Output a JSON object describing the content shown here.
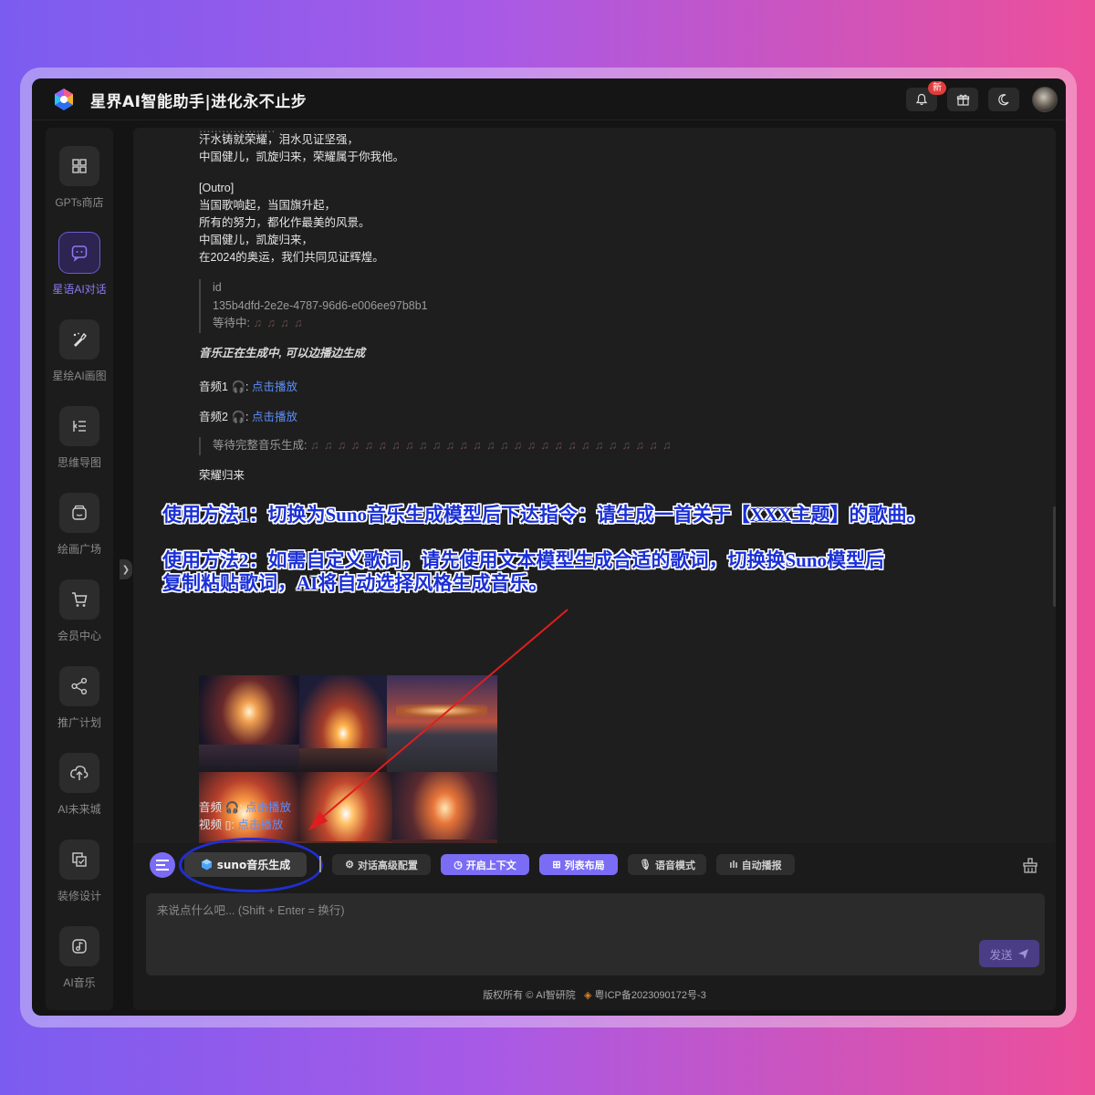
{
  "app": {
    "title": "星界AI智能助手|进化永不止步",
    "new_badge": "新"
  },
  "sidebar": {
    "items": [
      {
        "label": "GPTs商店",
        "icon": "grid-icon"
      },
      {
        "label": "星语AI对话",
        "icon": "chat-icon",
        "active": true
      },
      {
        "label": "星绘AI画图",
        "icon": "paint-icon"
      },
      {
        "label": "思维导图",
        "icon": "mindmap-icon"
      },
      {
        "label": "绘画广场",
        "icon": "gallery-icon"
      },
      {
        "label": "会员中心",
        "icon": "cart-icon"
      },
      {
        "label": "推广计划",
        "icon": "share-icon"
      },
      {
        "label": "AI未来城",
        "icon": "cloud-upload-icon"
      },
      {
        "label": "装修设计",
        "icon": "design-icon"
      },
      {
        "label": "AI音乐",
        "icon": "music-icon"
      }
    ]
  },
  "chat": {
    "lyrics_top": [
      "汗水铸就荣耀，泪水见证坚强，",
      "中国健儿，凯旋归来，荣耀属于你我他。"
    ],
    "outro_tag": "[Outro]",
    "outro_lines": [
      "当国歌响起，当国旗升起，",
      "所有的努力，都化作最美的风景。",
      "中国健儿，凯旋归来，",
      "在2024的奥运，我们共同见证辉煌。"
    ],
    "task": {
      "id_label": "id",
      "id_value": "135b4dfd-2e2e-4787-96d6-e006ee97b8b1",
      "waiting_label": "等待中:",
      "waiting_notes": "♫ ♫ ♫ ♫"
    },
    "generating_note": "音乐正在生成中, 可以边播边生成",
    "audio1": {
      "label": "音频1",
      "link": "点击播放"
    },
    "audio2": {
      "label": "音频2",
      "link": "点击播放"
    },
    "waiting_full": {
      "label": "等待完整音乐生成:",
      "notes": "♫ ♫ ♫ ♫ ♫ ♫ ♫ ♫ ♫ ♫ ♫ ♫ ♫ ♫ ♫ ♫ ♫ ♫ ♫ ♫ ♫ ♫ ♫ ♫ ♫ ♫ ♫"
    },
    "song_title": "荣耀归来",
    "audio3": {
      "label": "音频",
      "link": "点击播放"
    },
    "video": {
      "label": "视频",
      "link": "点击播放"
    }
  },
  "annotations": {
    "method1": "使用方法1：切换为Suno音乐生成模型后下达指令：请生成一首关于【XXX主题】的歌曲。",
    "method2_line1": "使用方法2：如需自定义歌词，请先使用文本模型生成合适的歌词，切换换Suno模型后",
    "method2_line2": "复制粘贴歌词，AI将自动选择风格生成音乐。"
  },
  "toolbar": {
    "model": "suno音乐生成",
    "advanced": "对话高级配置",
    "context": "开启上下文",
    "layout": "列表布局",
    "voice": "语音模式",
    "autoplay": "自动播报"
  },
  "input": {
    "placeholder": "来说点什么吧... (Shift + Enter = 换行)",
    "send": "发送"
  },
  "footer": {
    "copyright": "版权所有 © AI智研院",
    "icp": "粤ICP备2023090172号-3"
  },
  "colors": {
    "accent": "#7b6cf6",
    "annotation_blue": "#1a2fd6",
    "arrow_red": "#e11d1d",
    "link": "#5b8ff9"
  }
}
